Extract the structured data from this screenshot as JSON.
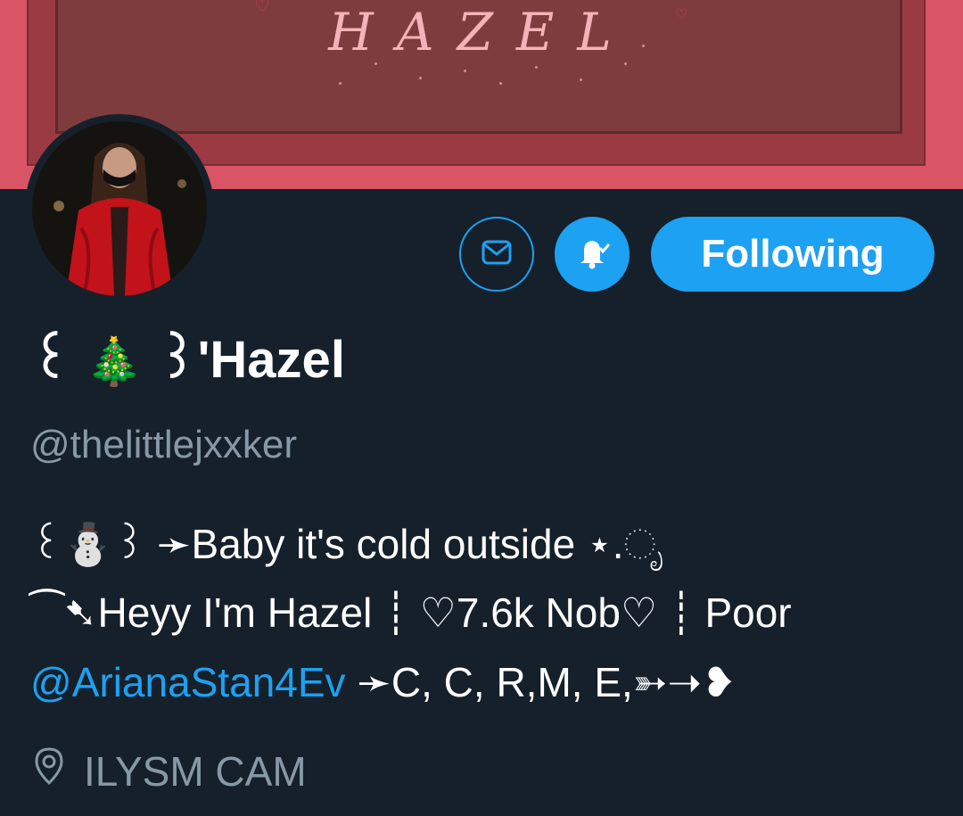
{
  "banner": {
    "title": "HAZEL"
  },
  "actions": {
    "message_icon": "mail-icon",
    "notify_icon": "bell-check-icon",
    "follow_label": "Following"
  },
  "profile": {
    "display_name_prefix": "꒰",
    "display_name_emoji": "🎄",
    "display_name_main": "꒱'Hazel",
    "handle": "@thelittlejxxker",
    "bio": {
      "line1_a": "꒰⛄꒱ ➛Baby it's cold outside ⋆.ೃ",
      "line2": "⁀➷Heyy I'm Hazel ┊ ♡7.6k Nob♡ ┊ Poor",
      "line3_mention": "@ArianaStan4Ev",
      "line3_rest": " ➛C, C, R,M, E,➳➝❥"
    },
    "location": "ILYSM CAM",
    "location_icon": "location-pin-icon"
  },
  "colors": {
    "background": "#15202b",
    "accent": "#1da1f2",
    "secondary_text": "#8899a6",
    "banner": "#d95565"
  }
}
